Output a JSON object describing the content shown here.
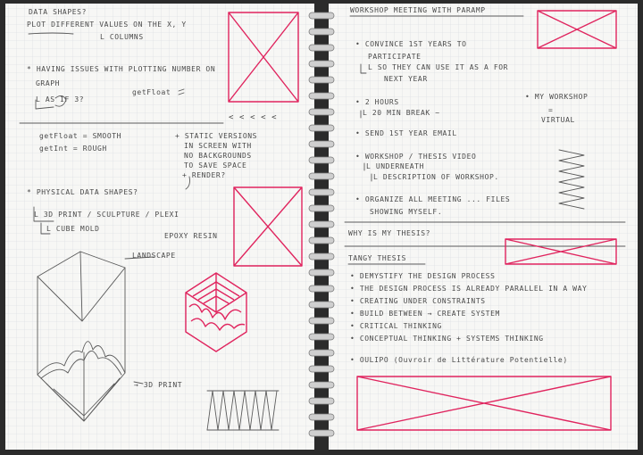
{
  "left_page": {
    "lines": [
      "DATA SHAPES?",
      "PLOT DIFFERENT VALUES ON THE X, Y",
      "L COLUMNS",
      "* HAVING ISSUES WITH PLOTTING NUMBER ON",
      "GRAPH",
      "getFloat",
      "L AS IF 3?",
      "< < < < <",
      "getFloat  =  SMOOTH",
      "getInt    =  ROUGH",
      "+ STATIC VERSIONS",
      "IN SCREEN WITH",
      "NO BACKGROUNDS",
      "TO SAVE SPACE",
      "+ RENDER?",
      "* PHYSICAL DATA SHAPES?",
      "L 3D PRINT / SCULPTURE / PLEXI",
      "L CUBE MOLD",
      "EPOXY RESIN",
      "LANDSCAPE",
      "→ 3D PRINT"
    ]
  },
  "right_page": {
    "lines": [
      "WORKSHOP MEETING WITH PARAMP",
      "• CONVINCE 1ST YEARS TO",
      "PARTICIPATE",
      "L SO THEY CAN USE IT AS A FOR",
      "NEXT YEAR",
      "• 2 HOURS",
      "L 20 MIN BREAK ~",
      "• MY WORKSHOP",
      "=",
      "VIRTUAL",
      "• SEND 1ST YEAR EMAIL",
      "• WORKSHOP / THESIS VIDEO",
      "L UNDERNEATH",
      "L DESCRIPTION OF WORKSHOP.",
      "• ORGANIZE ALL MEETING ... FILES",
      "SHOWING MYSELF.",
      "WHY IS MY THESIS?",
      "TANGY THESIS",
      "• DEMYSTIFY THE DESIGN PROCESS",
      "• THE DESIGN PROCESS IS ALREADY PARALLEL IN A WAY",
      "• CREATING UNDER CONSTRAINTS",
      "• BUILD BETWEEN → CREATE SYSTEM",
      "• CRITICAL THINKING",
      "• CONCEPTUAL THINKING + SYSTEMS THINKING",
      "• OULIPO   (Ouvroir de Littérature Potentielle)"
    ]
  },
  "colors": {
    "paper": "#f7f7f5",
    "grid": "#d5d8dd",
    "ink": "#4a4a4a",
    "red_ink": "#e0245e",
    "spiral": "#bdbdbd"
  }
}
